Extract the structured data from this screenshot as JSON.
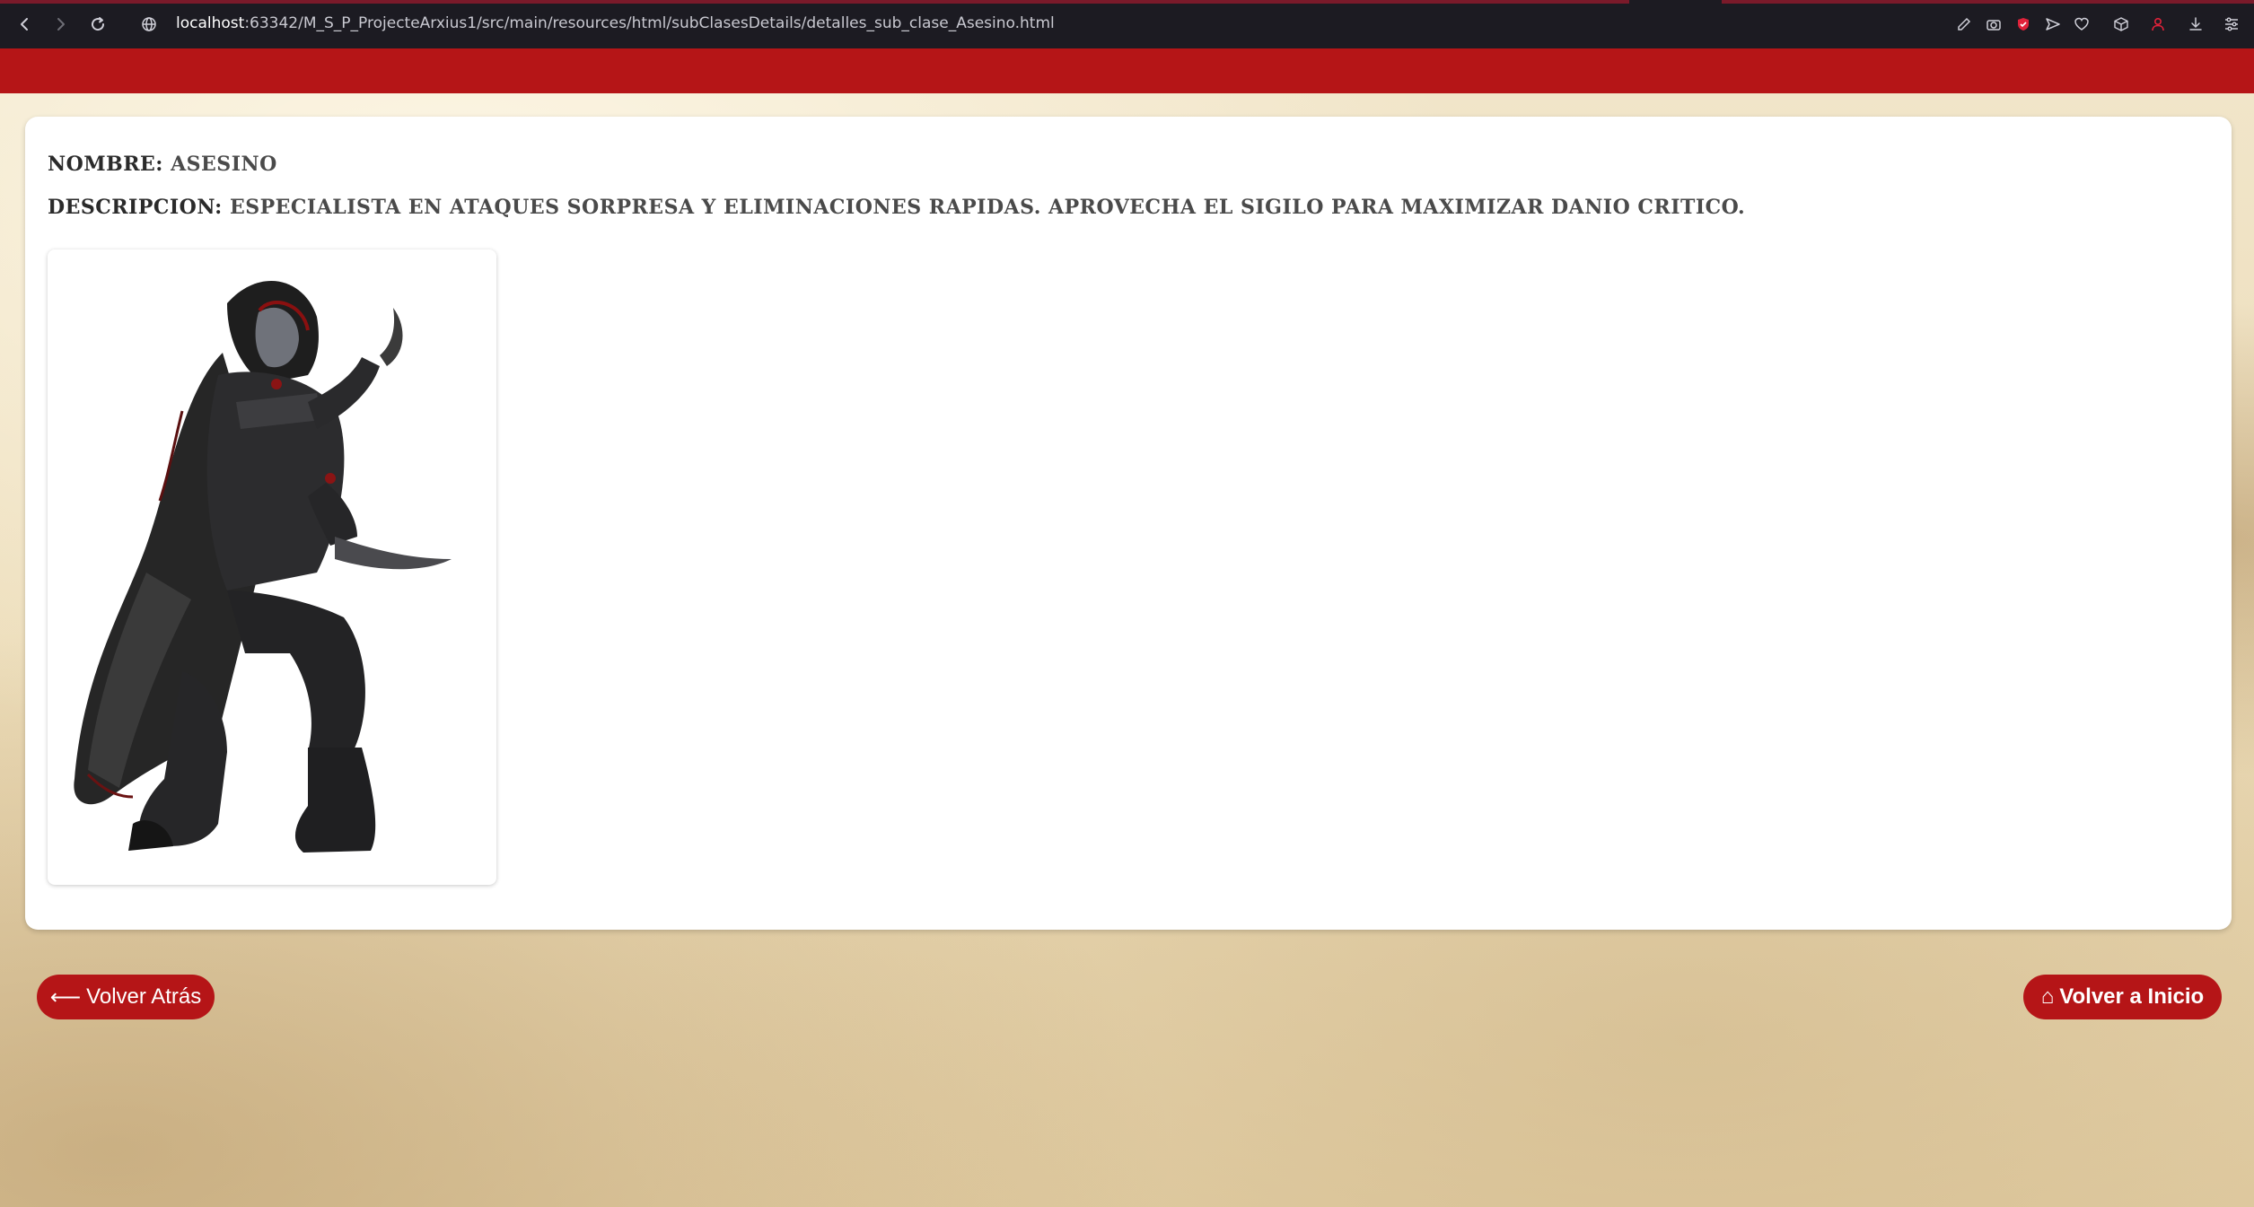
{
  "browser": {
    "url_host": "localhost",
    "url_path": ":63342/M_S_P_ProjecteArxius1/src/main/resources/html/subClasesDetails/detalles_sub_clase_Asesino.html"
  },
  "detail": {
    "name_label": "NOMBRE:",
    "name_value": "ASESINO",
    "description_label": "DESCRIPCION:",
    "description_value": "ESPECIALISTA EN ATAQUES SORPRESA Y ELIMINACIONES RAPIDAS. APROVECHA EL SIGILO PARA MAXIMIZAR DANIO CRITICO."
  },
  "buttons": {
    "back_glyph": "⟵",
    "back_label": "Volver Atrás",
    "home_glyph": "⌂",
    "home_label": "Volver a Inicio"
  },
  "colors": {
    "accent_red": "#b51517",
    "chrome_bg": "#1c1b22",
    "card_bg": "#ffffff",
    "text_dark": "#4a4a4a"
  },
  "icons": {
    "back": "arrow-left-icon",
    "forward": "arrow-right-icon",
    "reload": "reload-icon",
    "site_info": "globe-icon",
    "home": "home-icon"
  }
}
